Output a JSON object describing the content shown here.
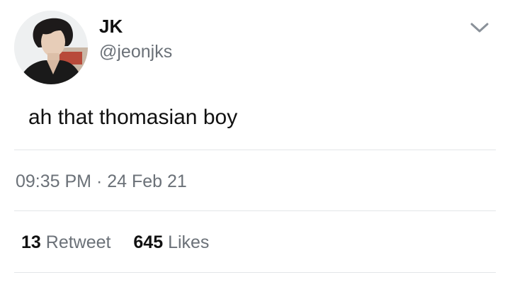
{
  "user": {
    "display_name": "JK",
    "handle": "@jeonjks"
  },
  "tweet": {
    "text": "ah that thomasian boy",
    "time": "09:35 PM",
    "separator": "·",
    "date": "24 Feb 21"
  },
  "stats": {
    "retweet_count": "13",
    "retweet_label": "Retweet",
    "likes_count": "645",
    "likes_label": "Likes"
  },
  "icons": {
    "menu": "chevron-down-icon",
    "avatar": "profile-photo"
  }
}
